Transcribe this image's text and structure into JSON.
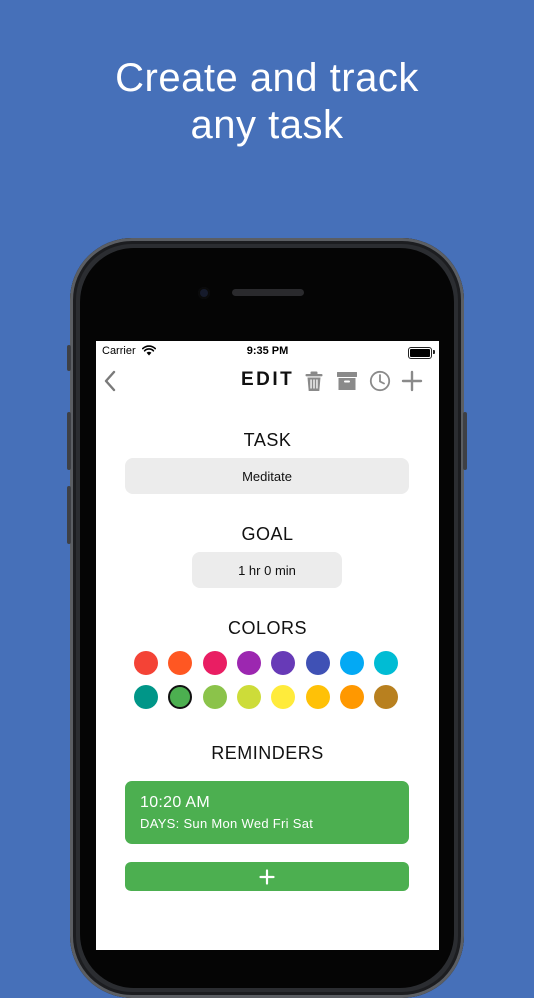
{
  "headline": {
    "line1": "Create and track",
    "line2": "any task"
  },
  "status_bar": {
    "carrier": "Carrier",
    "time": "9:35 PM"
  },
  "nav": {
    "title": "EDIT",
    "icons": [
      "back-chevron-icon",
      "trash-icon",
      "archive-icon",
      "clock-icon",
      "plus-icon"
    ]
  },
  "task": {
    "label": "TASK",
    "value": "Meditate"
  },
  "goal": {
    "label": "GOAL",
    "value": "1 hr 0 min"
  },
  "colors": {
    "label": "COLORS",
    "selected": "#4caf50",
    "palette_row1": [
      "#f44336",
      "#ff5722",
      "#e91e63",
      "#9c27b0",
      "#673ab7",
      "#3f51b5",
      "#03a9f4",
      "#00bcd4"
    ],
    "palette_row2": [
      "#009688",
      "#4caf50",
      "#8bc34a",
      "#cddc39",
      "#ffeb3b",
      "#ffc107",
      "#ff9800",
      "#b8801f"
    ]
  },
  "reminders": {
    "label": "REMINDERS",
    "items": [
      {
        "time": "10:20 AM",
        "days": "DAYS: Sun Mon Wed Fri Sat"
      }
    ],
    "add_label": "+"
  },
  "theme": {
    "background": "#4670b9",
    "accent": "#4caf50",
    "icon_gray": "#8a8a8a"
  }
}
